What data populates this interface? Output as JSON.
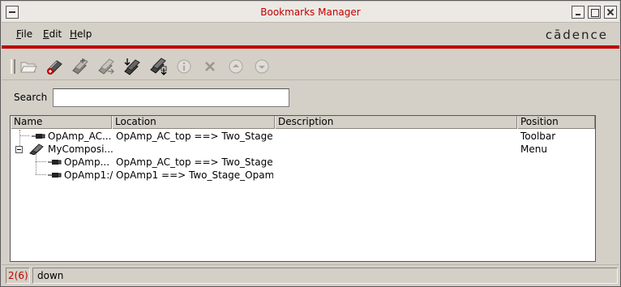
{
  "window": {
    "title": "Bookmarks Manager"
  },
  "menubar": {
    "file": {
      "accel": "F",
      "rest": "ile"
    },
    "edit": {
      "accel": "E",
      "rest": "dit"
    },
    "help": {
      "accel": "H",
      "rest": "elp"
    },
    "brand": "cādence"
  },
  "toolbar": {
    "icons": [
      "grip-icon",
      "open-folder-icon",
      "add-bookmark-icon",
      "new-folder-icon",
      "move-icon",
      "import-icon",
      "export-icon",
      "info-icon",
      "delete-icon",
      "move-up-icon",
      "move-down-icon"
    ]
  },
  "search": {
    "label": "Search",
    "value": "",
    "placeholder": ""
  },
  "table": {
    "columns": [
      "Name",
      "Location",
      "Description",
      "Position"
    ],
    "rows": [
      {
        "name": "OpAmp_AC...",
        "location": "OpAmp_AC_top ==> Two_Stage...",
        "description": "",
        "position": "Toolbar",
        "level": 0,
        "type": "bookmark"
      },
      {
        "name": "MyComposi...",
        "location": "",
        "description": "",
        "position": "Menu",
        "level": 0,
        "type": "folder",
        "expanded": true
      },
      {
        "name": "OpAmp...",
        "location": "OpAmp_AC_top ==> Two_Stage...",
        "description": "",
        "position": "",
        "level": 1,
        "type": "bookmark"
      },
      {
        "name": "OpAmp1:/",
        "location": "OpAmp1 ==> Two_Stage_Opam...",
        "description": "",
        "position": "",
        "level": 1,
        "type": "bookmark"
      }
    ]
  },
  "status": {
    "count": "2(6)",
    "message": "down"
  },
  "colors": {
    "accent": "#c00000",
    "chrome": "#d4d0c8"
  }
}
